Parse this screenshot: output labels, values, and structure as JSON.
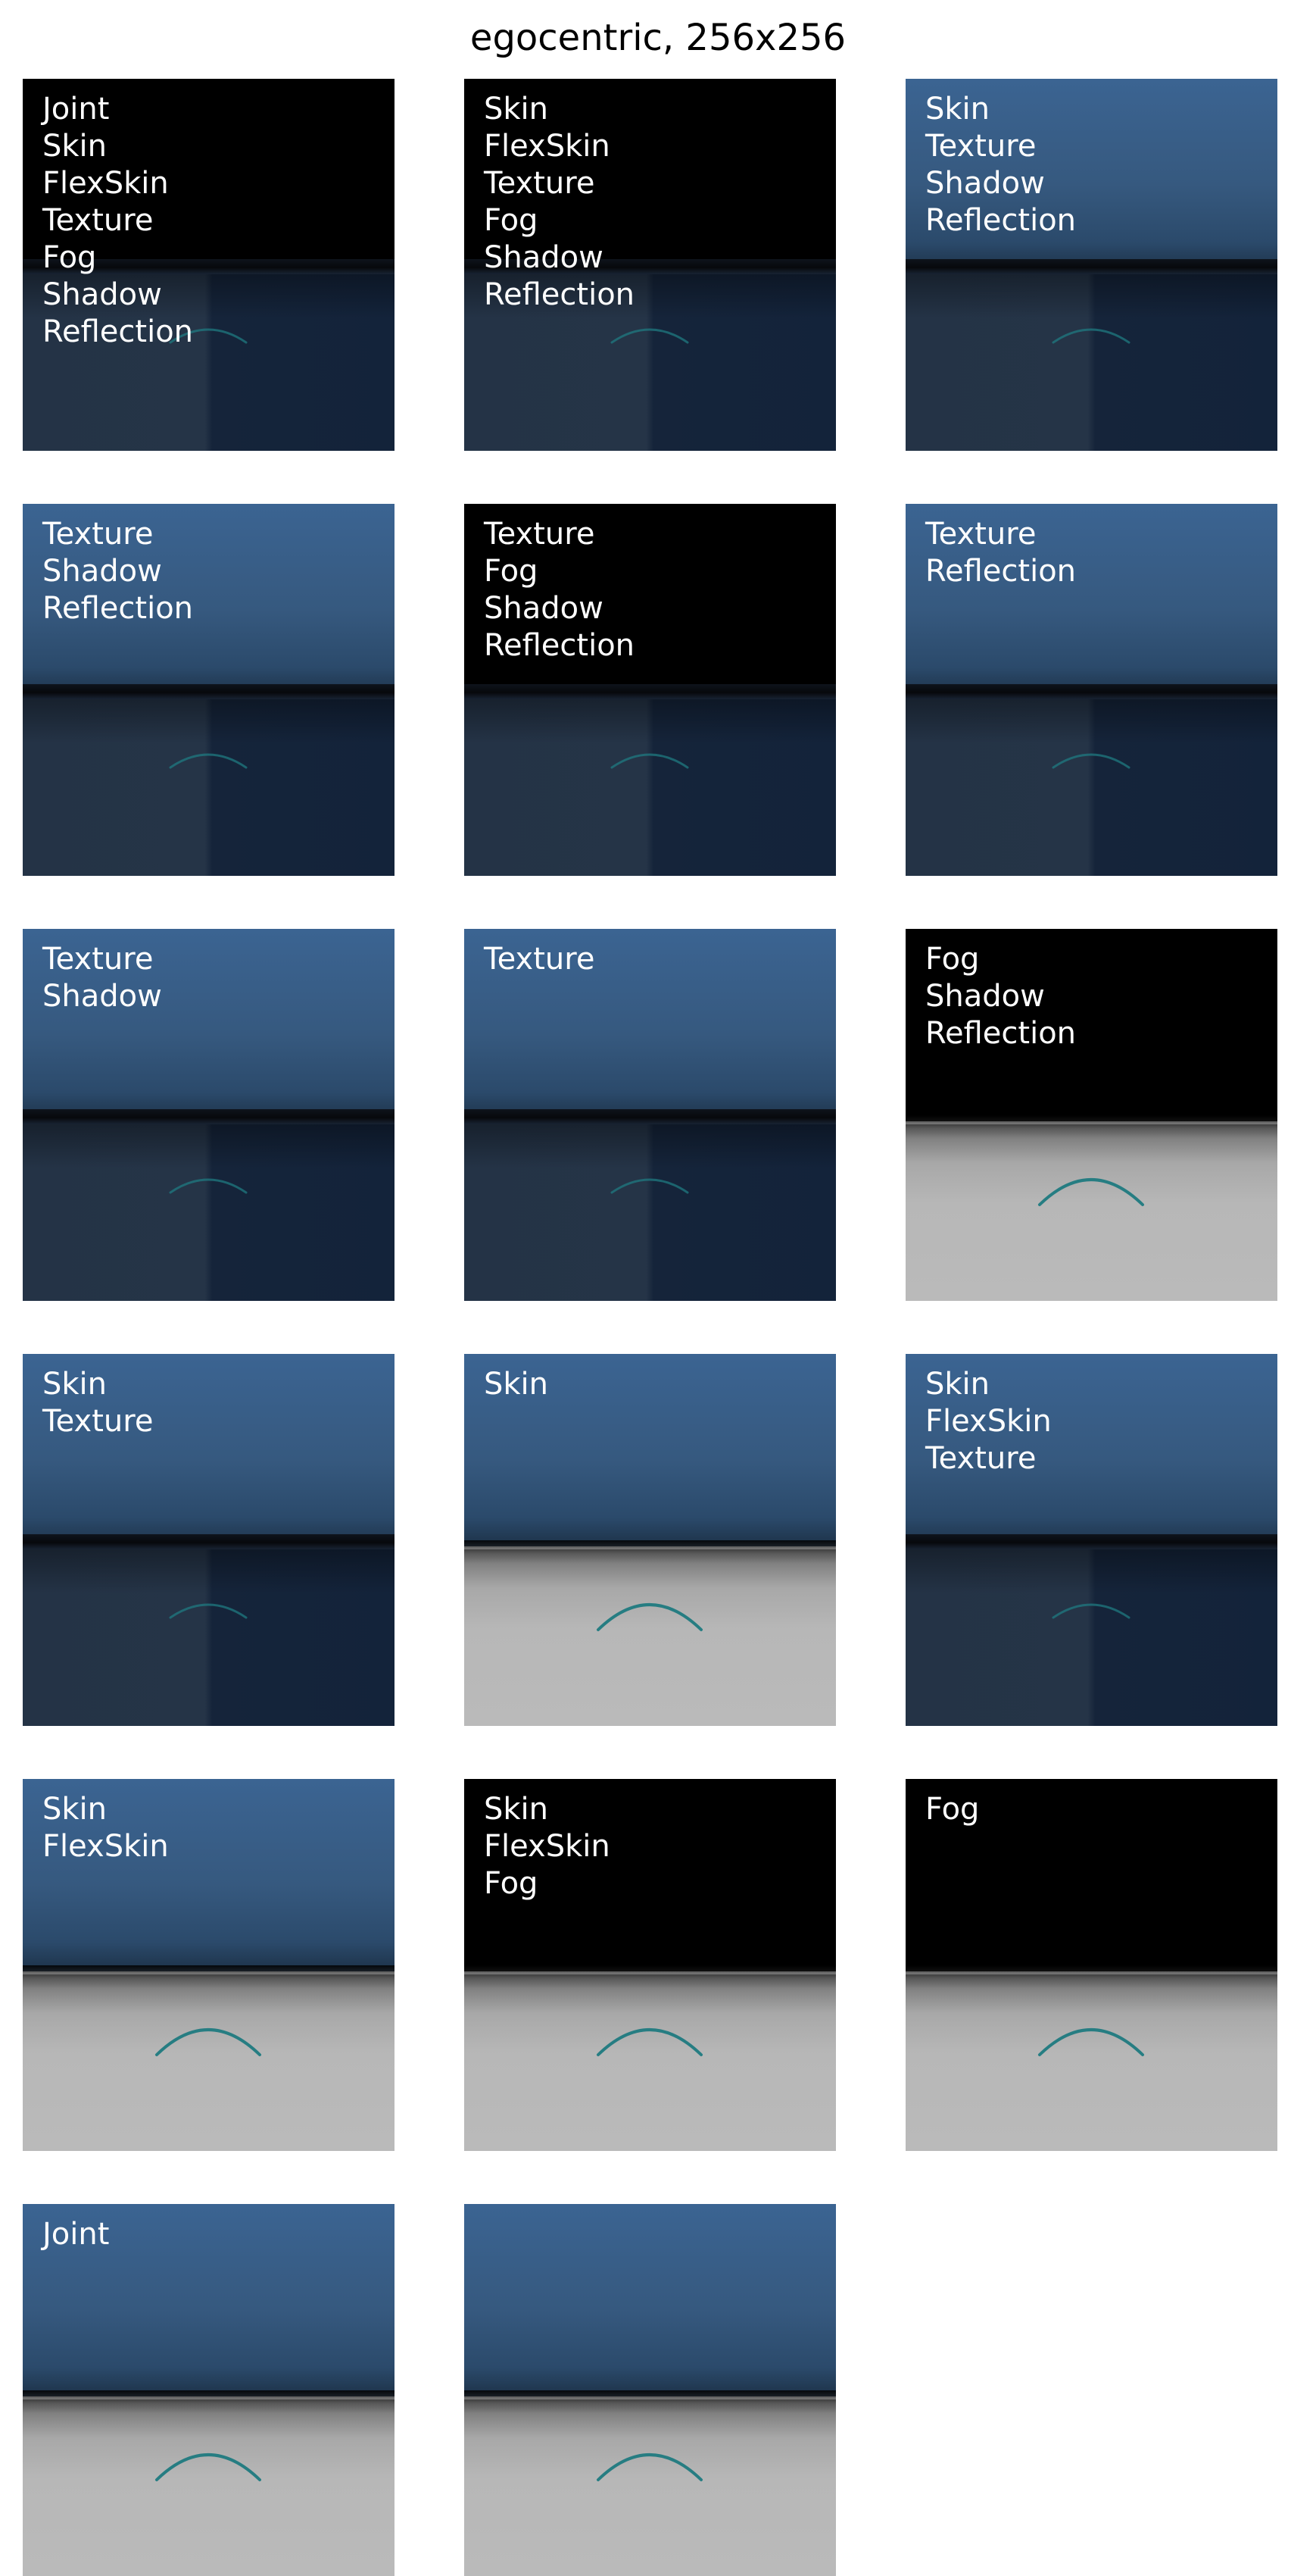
{
  "figure": {
    "title": "egocentric, 256x256"
  },
  "panels": [
    {
      "labels": [
        "Joint",
        "Skin",
        "FlexSkin",
        "Texture",
        "Fog",
        "Shadow",
        "Reflection"
      ],
      "sky": "black",
      "floor": "textured"
    },
    {
      "labels": [
        "Skin",
        "FlexSkin",
        "Texture",
        "Fog",
        "Shadow",
        "Reflection"
      ],
      "sky": "black",
      "floor": "textured"
    },
    {
      "labels": [
        "Skin",
        "Texture",
        "Shadow",
        "Reflection"
      ],
      "sky": "blue",
      "floor": "textured"
    },
    {
      "labels": [
        "Texture",
        "Shadow",
        "Reflection"
      ],
      "sky": "blue",
      "floor": "textured"
    },
    {
      "labels": [
        "Texture",
        "Fog",
        "Shadow",
        "Reflection"
      ],
      "sky": "black",
      "floor": "textured"
    },
    {
      "labels": [
        "Texture",
        "Reflection"
      ],
      "sky": "blue",
      "floor": "textured"
    },
    {
      "labels": [
        "Texture",
        "Shadow"
      ],
      "sky": "blue",
      "floor": "textured"
    },
    {
      "labels": [
        "Texture"
      ],
      "sky": "blue",
      "floor": "textured"
    },
    {
      "labels": [
        "Fog",
        "Shadow",
        "Reflection"
      ],
      "sky": "black",
      "floor": "gray"
    },
    {
      "labels": [
        "Skin",
        "Texture"
      ],
      "sky": "blue",
      "floor": "textured"
    },
    {
      "labels": [
        "Skin"
      ],
      "sky": "blue",
      "floor": "gray"
    },
    {
      "labels": [
        "Skin",
        "FlexSkin",
        "Texture"
      ],
      "sky": "blue",
      "floor": "textured"
    },
    {
      "labels": [
        "Skin",
        "FlexSkin"
      ],
      "sky": "blue",
      "floor": "gray"
    },
    {
      "labels": [
        "Skin",
        "FlexSkin",
        "Fog"
      ],
      "sky": "black",
      "floor": "gray"
    },
    {
      "labels": [
        "Fog"
      ],
      "sky": "black",
      "floor": "gray"
    },
    {
      "labels": [
        "Joint"
      ],
      "sky": "blue",
      "floor": "gray"
    },
    {
      "labels": [],
      "sky": "blue",
      "floor": "gray"
    }
  ],
  "colors": {
    "arc": "#1f7a80",
    "label_text": "#ffffff"
  }
}
